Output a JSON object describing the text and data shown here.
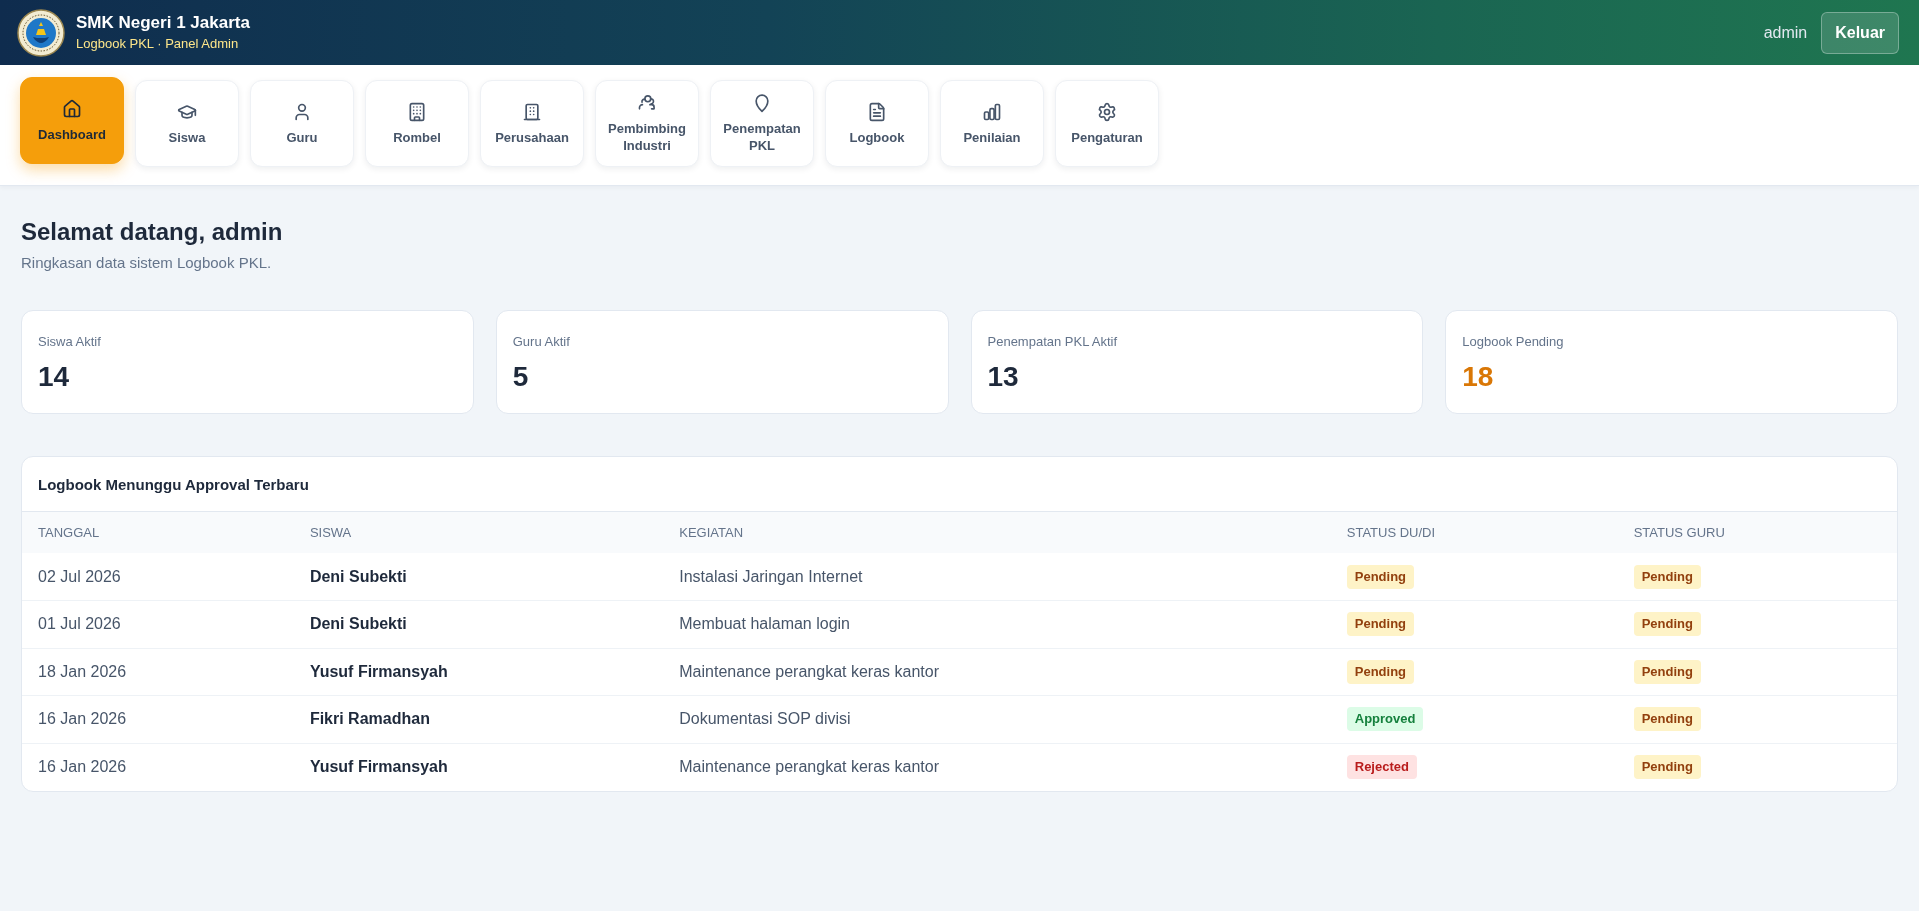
{
  "header": {
    "title": "SMK Negeri 1 Jakarta",
    "subtitle": "Logbook PKL · Panel Admin",
    "user": "admin",
    "logout": "Keluar"
  },
  "nav": {
    "items": [
      {
        "label": "Dashboard",
        "selected": true
      },
      {
        "label": "Siswa",
        "selected": false
      },
      {
        "label": "Guru",
        "selected": false
      },
      {
        "label": "Rombel",
        "selected": false
      },
      {
        "label": "Perusahaan",
        "selected": false
      },
      {
        "label": "Pembimbing Industri",
        "selected": false
      },
      {
        "label": "Penempatan PKL",
        "selected": false
      },
      {
        "label": "Logbook",
        "selected": false
      },
      {
        "label": "Penilaian",
        "selected": false
      },
      {
        "label": "Pengaturan",
        "selected": false
      }
    ]
  },
  "welcome": {
    "title": "Selamat datang, admin",
    "subtitle": "Ringkasan data sistem Logbook PKL."
  },
  "stats": [
    {
      "label": "Siswa Aktif",
      "value": "14",
      "highlight": false
    },
    {
      "label": "Guru Aktif",
      "value": "5",
      "highlight": false
    },
    {
      "label": "Penempatan PKL Aktif",
      "value": "13",
      "highlight": false
    },
    {
      "label": "Logbook Pending",
      "value": "18",
      "highlight": true
    }
  ],
  "table": {
    "title": "Logbook Menunggu Approval Terbaru",
    "columns": [
      "TANGGAL",
      "SISWA",
      "KEGIATAN",
      "STATUS DU/DI",
      "STATUS GURU"
    ],
    "rows": [
      {
        "date": "02 Jul 2026",
        "student": "Deni Subekti",
        "activity": "Instalasi Jaringan Internet",
        "status_dudi": {
          "label": "Pending",
          "kind": "pending"
        },
        "status_guru": {
          "label": "Pending",
          "kind": "pending"
        }
      },
      {
        "date": "01 Jul 2026",
        "student": "Deni Subekti",
        "activity": "Membuat halaman login",
        "status_dudi": {
          "label": "Pending",
          "kind": "pending"
        },
        "status_guru": {
          "label": "Pending",
          "kind": "pending"
        }
      },
      {
        "date": "18 Jan 2026",
        "student": "Yusuf Firmansyah",
        "activity": "Maintenance perangkat keras kantor",
        "status_dudi": {
          "label": "Pending",
          "kind": "pending"
        },
        "status_guru": {
          "label": "Pending",
          "kind": "pending"
        }
      },
      {
        "date": "16 Jan 2026",
        "student": "Fikri Ramadhan",
        "activity": "Dokumentasi SOP divisi",
        "status_dudi": {
          "label": "Approved",
          "kind": "approved"
        },
        "status_guru": {
          "label": "Pending",
          "kind": "pending"
        }
      },
      {
        "date": "16 Jan 2026",
        "student": "Yusuf Firmansyah",
        "activity": "Maintenance perangkat keras kantor",
        "status_dudi": {
          "label": "Rejected",
          "kind": "rejected"
        },
        "status_guru": {
          "label": "Pending",
          "kind": "pending"
        }
      }
    ]
  }
}
